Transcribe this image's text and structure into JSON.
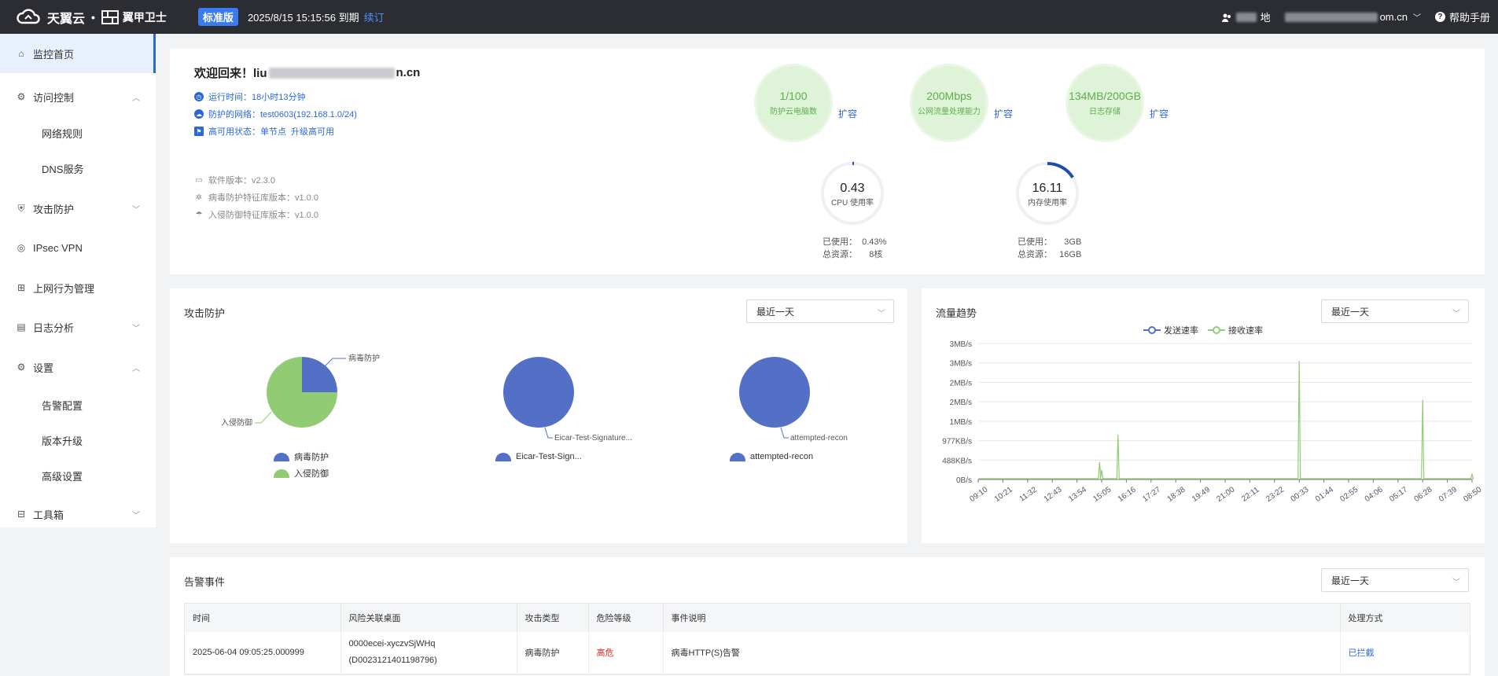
{
  "topbar": {
    "brand": "天翼云",
    "product": "翼甲卫士",
    "edition": "标准版",
    "expire": "2025/8/15 15:15:56 到期",
    "renew": "续订",
    "location": "地",
    "account_suffix": "om.cn",
    "help": "帮助手册"
  },
  "sidebar": {
    "items": [
      {
        "label": "监控首页",
        "icon": "home-icon"
      },
      {
        "label": "访问控制",
        "icon": "access-control-icon"
      },
      {
        "label": "网络规则"
      },
      {
        "label": "DNS服务"
      },
      {
        "label": "攻击防护",
        "icon": "shield-icon"
      },
      {
        "label": "IPsec VPN",
        "icon": "vpn-icon"
      },
      {
        "label": "上网行为管理",
        "icon": "behavior-icon"
      },
      {
        "label": "日志分析",
        "icon": "log-icon"
      },
      {
        "label": "设置",
        "icon": "gear-icon"
      },
      {
        "label": "告警配置"
      },
      {
        "label": "版本升级"
      },
      {
        "label": "高级设置"
      },
      {
        "label": "工具箱",
        "icon": "toolbox-icon"
      }
    ]
  },
  "welcome": {
    "greeting_prefix": "欢迎回来！liu",
    "greeting_suffix": "n.cn",
    "uptime": "运行时间：18小时13分钟",
    "network": "防护的网络：test0603(192.168.1.0/24)",
    "ha_status": "高可用状态：单节点",
    "ha_upgrade": "升级高可用",
    "software_version": "软件版本：v2.3.0",
    "virus_db": "病毒防护特征库版本：v1.0.0",
    "ips_db": "入侵防御特征库版本：v1.0.0"
  },
  "capacity": [
    {
      "value": "1/100",
      "label": "防护云电脑数",
      "action": "扩容"
    },
    {
      "value": "200Mbps",
      "label": "公网流量处理能力",
      "action": "扩容"
    },
    {
      "value": "134MB/200GB",
      "label": "日志存储",
      "action": "扩容"
    }
  ],
  "gauges": {
    "cpu": {
      "value": "0.43",
      "label": "CPU 使用率",
      "percent": 0.43,
      "used": "已使用：  0.43%",
      "total": "总资源：     8核"
    },
    "mem": {
      "value": "16.11",
      "label": "内存使用率",
      "percent": 16.11,
      "used": "已使用：     3GB",
      "total": "总资源：   16GB"
    }
  },
  "attack": {
    "title": "攻击防护",
    "range": "最近一天",
    "pie1": {
      "labels": [
        "病毒防护",
        "入侵防御"
      ],
      "values": [
        25,
        75
      ],
      "colors": [
        "#5470c6",
        "#91cc75"
      ]
    },
    "pie2": {
      "label": "Eicar-Test-Signature...",
      "legend": "Eicar-Test-Sign...",
      "color": "#5470c6"
    },
    "pie3": {
      "label": "attempted-recon",
      "legend": "attempted-recon",
      "color": "#5470c6"
    }
  },
  "traffic": {
    "title": "流量趋势",
    "range": "最近一天",
    "legend_send": "发送速率",
    "legend_recv": "接收速率",
    "send_color": "#5470c6",
    "recv_color": "#91cc75"
  },
  "chart_data": {
    "type": "line",
    "title": "流量趋势",
    "y_ticks": [
      "0B/s",
      "488KB/s",
      "977KB/s",
      "1MB/s",
      "2MB/s",
      "2MB/s",
      "3MB/s",
      "3MB/s"
    ],
    "x_ticks": [
      "09:10",
      "10:21",
      "11:32",
      "12:43",
      "13:54",
      "15:05",
      "16:16",
      "17:27",
      "18:38",
      "19:49",
      "21:00",
      "22:11",
      "23:22",
      "00:33",
      "01:44",
      "02:55",
      "04:06",
      "05:17",
      "06:28",
      "07:39",
      "08:50"
    ],
    "series": [
      {
        "name": "发送速率",
        "values": []
      },
      {
        "name": "接收速率",
        "spikes": [
          {
            "x": "14:59",
            "y_tick_index": 0.9
          },
          {
            "x": "15:05",
            "y_tick_index": 0.5
          },
          {
            "x": "15:52",
            "y_tick_index": 2.3
          },
          {
            "x": "00:33",
            "y_tick_index": 6.1
          },
          {
            "x": "06:28",
            "y_tick_index": 4.1
          },
          {
            "x": "08:50",
            "y_tick_index": 0.3
          }
        ]
      }
    ]
  },
  "alerts": {
    "title": "告警事件",
    "range": "最近一天",
    "columns": [
      "时间",
      "风险关联桌面",
      "攻击类型",
      "危险等级",
      "事件说明",
      "处理方式"
    ],
    "rows": [
      {
        "time": "2025-06-04 09:05:25.000999",
        "desktop_line1": "0000ecei-xyczvSjWHq",
        "desktop_line2": "(D0023121401198796)",
        "type": "病毒防护",
        "level": "高危",
        "desc": "病毒HTTP(S)告警",
        "action": "已拦截"
      }
    ]
  }
}
